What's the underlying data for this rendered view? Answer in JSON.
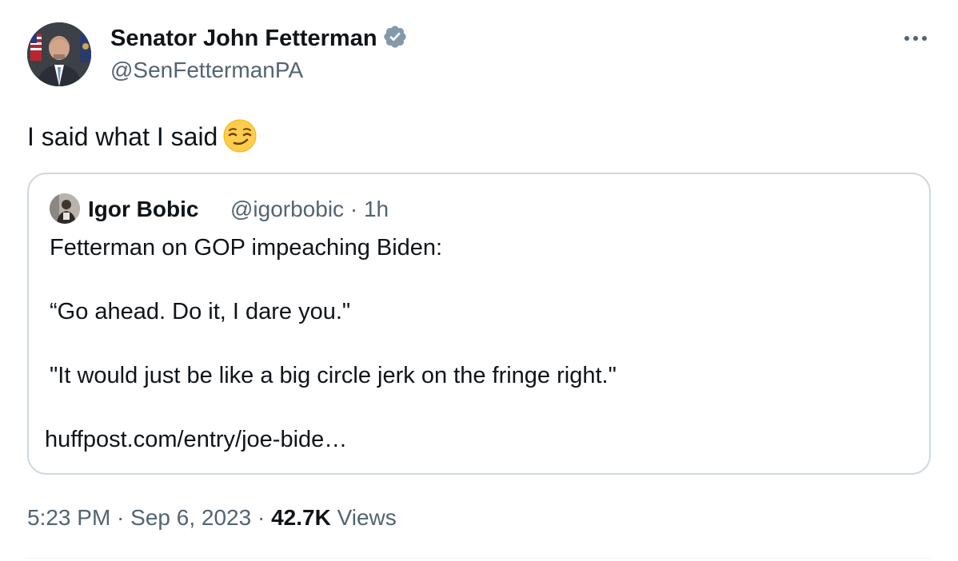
{
  "author": {
    "name": "Senator John Fetterman",
    "handle": "@SenFettermanPA",
    "verified_icon": "verified-badge-icon",
    "verified_color": "#829aab"
  },
  "tweet": {
    "text": "I said what I said",
    "emoji": "smirking-face"
  },
  "quoted": {
    "name": "Igor Bobic",
    "handle": "@igorbobic",
    "time": "1h",
    "lines": [
      "Fetterman on GOP impeaching Biden:",
      "“Go ahead. Do it, I dare you.\"",
      "\"It would just be like a big circle jerk on the fringe right.\""
    ],
    "link": "huffpost.com/entry/joe-bide…"
  },
  "meta": {
    "time": "5:23 PM",
    "date": "Sep 6, 2023",
    "views_count": "42.7K",
    "views_label": "Views"
  },
  "colors": {
    "text": "#0f1419",
    "secondary": "#536471",
    "border": "#cfd9de"
  }
}
